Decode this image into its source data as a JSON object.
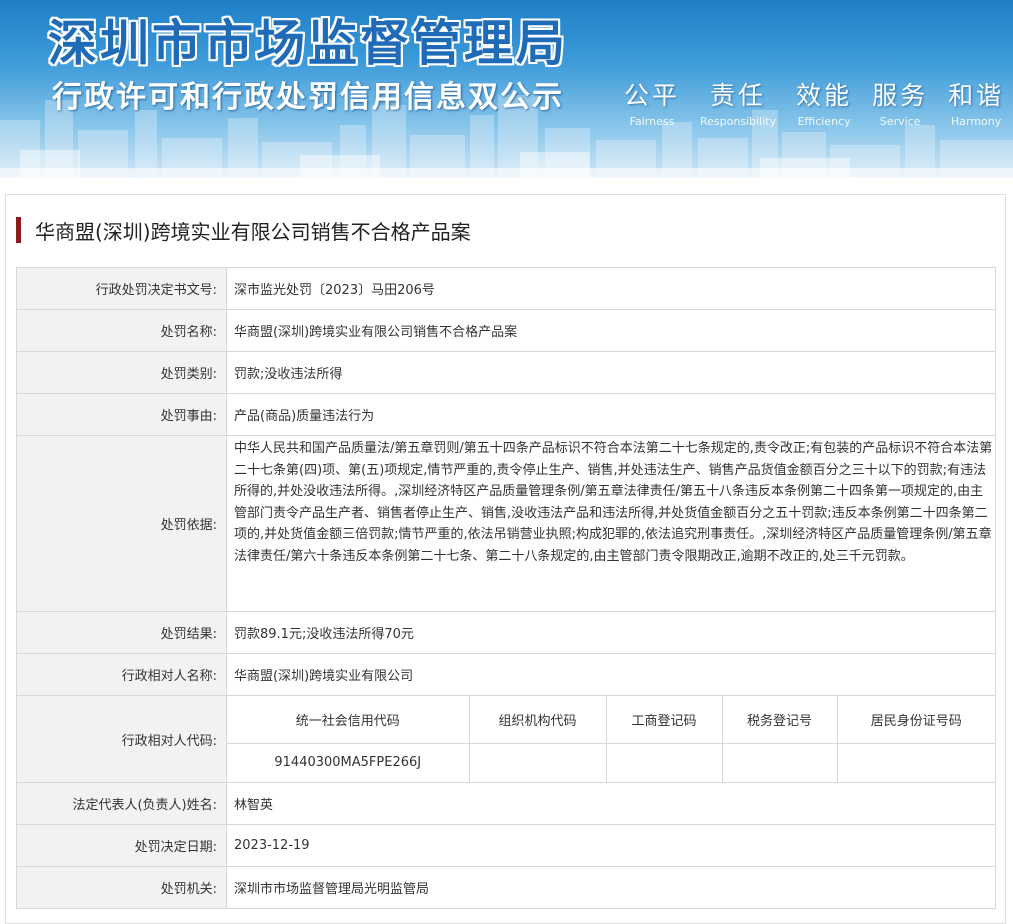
{
  "banner": {
    "title": "深圳市市场监督管理局",
    "subtitle": "行政许可和行政处罚信用信息双公示",
    "slogans": [
      {
        "zh": "公平",
        "en": "Fairness"
      },
      {
        "zh": "责任",
        "en": "Responsibility"
      },
      {
        "zh": "效能",
        "en": "Efficiency"
      },
      {
        "zh": "服务",
        "en": "Service"
      },
      {
        "zh": "和谐",
        "en": "Harmony"
      }
    ]
  },
  "page_title": "华商盟(深圳)跨境实业有限公司销售不合格产品案",
  "fields": {
    "decision_no": {
      "label": "行政处罚决定书文号:",
      "value": "深市监光处罚〔2023〕马田206号"
    },
    "penalty_name": {
      "label": "处罚名称:",
      "value": "华商盟(深圳)跨境实业有限公司销售不合格产品案"
    },
    "penalty_type": {
      "label": "处罚类别:",
      "value": "罚款;没收违法所得"
    },
    "penalty_reason": {
      "label": "处罚事由:",
      "value": "产品(商品)质量违法行为"
    },
    "penalty_basis": {
      "label": "处罚依据:",
      "value": "中华人民共和国产品质量法/第五章罚则/第五十四条产品标识不符合本法第二十七条规定的,责令改正;有包装的产品标识不符合本法第二十七条第(四)项、第(五)项规定,情节严重的,责令停止生产、销售,并处违法生产、销售产品货值金额百分之三十以下的罚款;有违法所得的,并处没收违法所得。,深圳经济特区产品质量管理条例/第五章法律责任/第五十八条违反本条例第二十四条第一项规定的,由主管部门责令产品生产者、销售者停止生产、销售,没收违法产品和违法所得,并处货值金额百分之五十罚款;违反本条例第二十四条第二项的,并处货值金额三倍罚款;情节严重的,依法吊销营业执照;构成犯罪的,依法追究刑事责任。,深圳经济特区产品质量管理条例/第五章法律责任/第六十条违反本条例第二十七条、第二十八条规定的,由主管部门责令限期改正,逾期不改正的,处三千元罚款。"
    },
    "penalty_result": {
      "label": "处罚结果:",
      "value": "罚款89.1元;没收违法所得70元"
    },
    "party_name": {
      "label": "行政相对人名称:",
      "value": "华商盟(深圳)跨境实业有限公司"
    },
    "party_code": {
      "label": "行政相对人代码:",
      "headers": [
        "统一社会信用代码",
        "组织机构代码",
        "工商登记码",
        "税务登记号",
        "居民身份证号码"
      ],
      "values": [
        "91440300MA5FPE266J",
        "",
        "",
        "",
        ""
      ]
    },
    "legal_rep": {
      "label": "法定代表人(负责人)姓名:",
      "value": "林智英"
    },
    "decision_date": {
      "label": "处罚决定日期:",
      "value": "2023-12-19"
    },
    "authority": {
      "label": "处罚机关:",
      "value": "深圳市市场监督管理局光明监管局"
    }
  }
}
